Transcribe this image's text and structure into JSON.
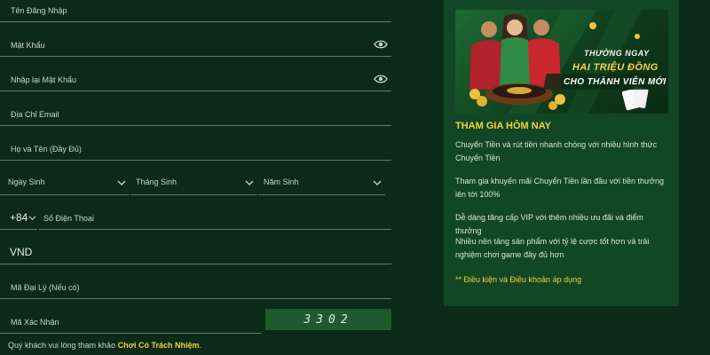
{
  "form": {
    "username_label": "Tên Đăng Nhập",
    "password_label": "Mật Khẩu",
    "confirm_password_label": "Nhập lại Mật Khẩu",
    "email_label": "Địa Chỉ Email",
    "fullname_label": "Họ và Tên (Đầy Đủ)",
    "birth_day_label": "Ngày Sinh",
    "birth_month_label": "Tháng Sinh",
    "birth_year_label": "Năm Sinh",
    "country_code": "+84",
    "phone_label": "Số Điện Thoại",
    "currency": "VND",
    "agent_code_label": "Mã Đại Lý (Nếu có)",
    "captcha_label": "Mã Xác Nhận",
    "captcha_value": "3302",
    "note_prefix": "Quý khách vui lòng tham khảo ",
    "note_link": "Chơi Có Trách Nhiệm",
    "note_suffix": "."
  },
  "panel": {
    "banner_line1": "THƯỞNG NGAY",
    "banner_line2": "HAI TRIỆU ĐỒNG",
    "banner_line3": "CHO THÀNH VIÊN MỚI",
    "heading": "THAM GIA HÔM NAY",
    "item1": "Chuyển Tiền và rút tiền nhanh chóng với nhiều hình thức Chuyển Tiền",
    "item2": "Tham gia khuyến mãi Chuyển Tiền lần đầu với tiền thưởng lên tới 100%",
    "item3": "Dễ dàng tăng cấp VIP với thêm nhiều ưu đãi và điểm thưởng",
    "item4": "Nhiều nền tảng sản phẩm với tỷ lệ cược tốt hơn và trải nghiệm chơi game đầy đủ hơn",
    "terms": "** Điều kiện và Điều khoản áp dụng"
  },
  "colors": {
    "background": "#0b2a17",
    "panel": "#124726",
    "accent": "#f2d23a",
    "captcha_bg": "#1f5a2f"
  }
}
